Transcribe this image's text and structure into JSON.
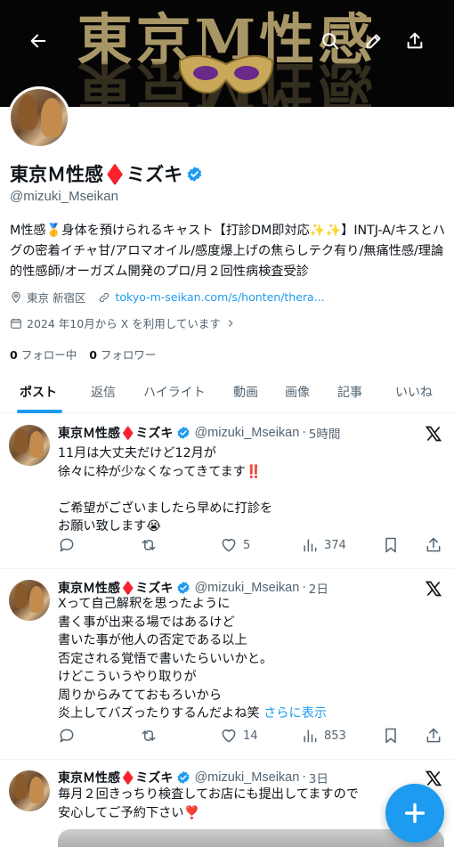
{
  "banner": {
    "text": "東京M性感"
  },
  "profile": {
    "display_name": "東京Ｍ性感♦️ミズキ",
    "handle": "@mizuki_Mseikan",
    "bio": "M性感🥇身体を預けられるキャスト【打診DM即対応✨✨】INTJ-A/キスとハグの密着イチャ甘/アロマオイル/感度爆上げの焦らしテク有り/無痛性感/理論的性感師/オーガズム開発のプロ/月２回性病検査受診",
    "location": "東京 新宿区",
    "website": "tokyo-m-seikan.com/s/honten/thera...",
    "joined": "2024 年10月から X を利用しています",
    "following_count": "0",
    "following_label": "フォロー中",
    "followers_count": "0",
    "followers_label": "フォロワー"
  },
  "tabs": [
    {
      "label": "ポスト"
    },
    {
      "label": "返信"
    },
    {
      "label": "ハイライト"
    },
    {
      "label": "動画"
    },
    {
      "label": "画像"
    },
    {
      "label": "記事"
    },
    {
      "label": "いいね"
    }
  ],
  "posts": [
    {
      "name": "東京Ｍ性感♦️ミズキ",
      "handle": "@mizuki_Mseikan",
      "time": "5時間",
      "text": "11月は大丈夫だけど12月が\n徐々に枠が少なくなってきてます‼️\n\nご希望がございましたら早めに打診を\nお願い致します😭",
      "show_more": "",
      "likes": "5",
      "views": "374"
    },
    {
      "name": "東京Ｍ性感♦️ミズキ",
      "handle": "@mizuki_Mseikan",
      "time": "2日",
      "text": "Xって自己解釈を思ったように\n書く事が出来る場ではあるけど\n書いた事が他人の否定である以上\n否定される覚悟で書いたらいいかと。\nけどこういうやり取りが\n周りからみてておもろいから\n炎上してバズったりするんだよね笑 ",
      "show_more": "さらに表示",
      "likes": "14",
      "views": "853"
    },
    {
      "name": "東京Ｍ性感♦️ミズキ",
      "handle": "@mizuki_Mseikan",
      "time": "3日",
      "text": "毎月２回きっちり検査してお店にも提出してますので\n安心してご予約下さい❣️",
      "show_more": "",
      "likes": "",
      "views": ""
    }
  ],
  "icons": {
    "back": "back-arrow-icon",
    "search": "search-icon",
    "edit": "edit-icon",
    "share": "share-icon",
    "verified": "verified-badge-icon",
    "location": "location-pin-icon",
    "link": "link-icon",
    "calendar": "calendar-icon",
    "reply": "reply-icon",
    "repost": "repost-icon",
    "like": "heart-icon",
    "views": "views-icon",
    "bookmark": "bookmark-icon",
    "compose": "plus-icon"
  },
  "colors": {
    "accent": "#1d9bf0",
    "text": "#0f1419",
    "muted": "#536471",
    "verified": "#1d9bf0"
  }
}
